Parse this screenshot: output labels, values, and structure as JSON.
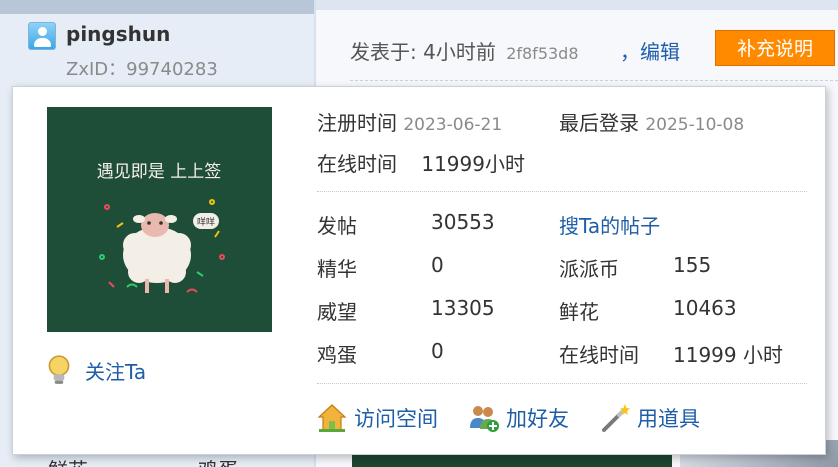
{
  "author": {
    "name": "pingshun",
    "zxid": "ZxID：99740283"
  },
  "post": {
    "posted_label": "发表于: 4小时前",
    "hash": "2f8f53d8",
    "edit_label": "，编辑",
    "supplement_label": "补充说明"
  },
  "background_fragments": [
    "鲜花",
    "鸡蛋"
  ],
  "card": {
    "avatar_text": "遇见即是 上上签",
    "avatar_bubble": "咩咩",
    "follow_label": "关注Ta",
    "register_label": "注册时间",
    "register_value": "2023-06-21",
    "lastlogin_label": "最后登录",
    "lastlogin_value": "2025-10-08",
    "online_label": "在线时间",
    "online_value": "11999小时",
    "stats": {
      "posts_label": "发帖",
      "posts_value": "30553",
      "search_posts_label": "搜Ta的帖子",
      "digest_label": "精华",
      "digest_value": "0",
      "coins_label": "派派币",
      "coins_value": "155",
      "prestige_label": "威望",
      "prestige_value": "13305",
      "flowers_label": "鲜花",
      "flowers_value": "10463",
      "eggs_label": "鸡蛋",
      "eggs_value": "0",
      "online2_label": "在线时间",
      "online2_value": "11999 小时"
    },
    "actions": {
      "visit_space": "访问空间",
      "add_friend": "加好友",
      "use_item": "用道具"
    }
  },
  "colors": {
    "link": "#1e5ea8",
    "accent_button": "#ff8a00",
    "avatar_bg": "#1e4d38"
  }
}
